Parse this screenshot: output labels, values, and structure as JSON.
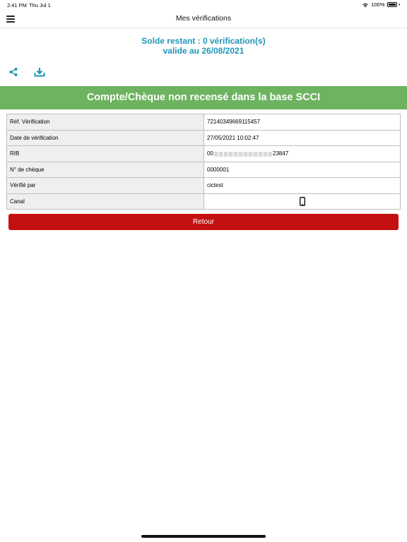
{
  "status_bar": {
    "time": "2:41 PM",
    "date": "Thu Jul 1",
    "battery": "100%"
  },
  "header": {
    "title": "Mes vérifications"
  },
  "balance": {
    "line1": "Solde restant : 0 vérification(s)",
    "line2": "valide au 26/08/2021"
  },
  "actions": {
    "share_icon": "share-icon",
    "download_icon": "download-icon"
  },
  "result": {
    "message": "Compte/Chèque non recensé dans la base SCCI",
    "color": "#6db360"
  },
  "details": {
    "rows": [
      {
        "label": "Réf. Vérification",
        "value": "72140349669115457"
      },
      {
        "label": "Date de vérification",
        "value": "27/05/2021 10:02:47"
      },
      {
        "label": "RIB",
        "value_prefix": "00",
        "value_suffix": "23847"
      },
      {
        "label": "N° de chèque",
        "value": "0000001"
      },
      {
        "label": "Vérifié par",
        "value": "cictest"
      },
      {
        "label": "Canal",
        "icon": "mobile-phone-icon"
      }
    ]
  },
  "back_button": {
    "label": "Retour",
    "color": "#c41010"
  },
  "colors": {
    "accent": "#2196b5",
    "success": "#6db360",
    "danger": "#c41010"
  }
}
